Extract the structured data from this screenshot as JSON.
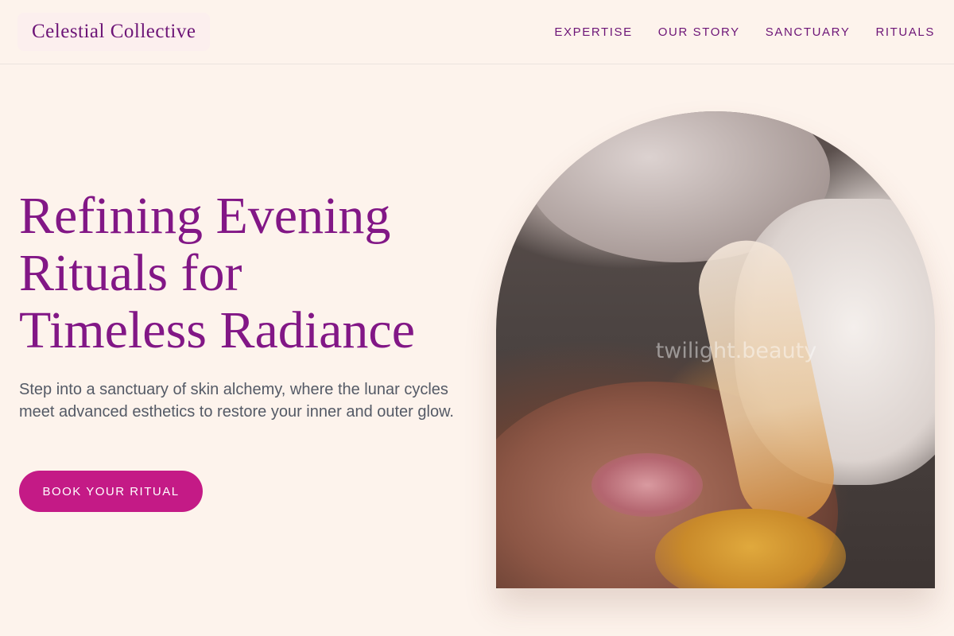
{
  "header": {
    "brand": "Celestial Collective",
    "nav": [
      {
        "label": "EXPERTISE"
      },
      {
        "label": "OUR STORY"
      },
      {
        "label": "SANCTUARY"
      },
      {
        "label": "RITUALS"
      }
    ]
  },
  "hero": {
    "title_lines": [
      "Refining Evening",
      "Rituals for",
      "Timeless Radiance"
    ],
    "subtitle": "Step into a sanctuary of skin alchemy, where the lunar cycles meet advanced esthetics to restore your inner and outer glow.",
    "cta_label": "BOOK YOUR RITUAL",
    "image_watermark": "twilight.beauty"
  },
  "colors": {
    "background": "#fdf3ec",
    "brand": "#6d1577",
    "title": "#821786",
    "cta": "#c41a86"
  }
}
